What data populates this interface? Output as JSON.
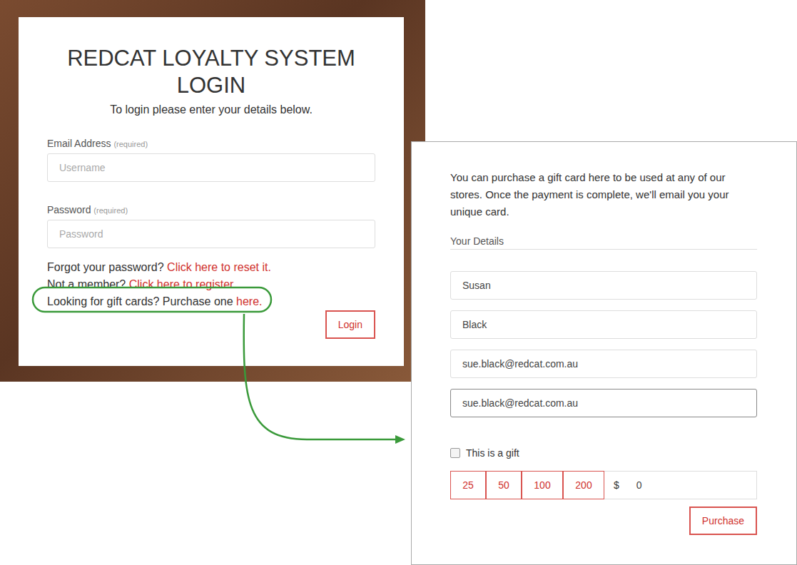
{
  "login": {
    "title_lines": [
      "REDCAT LOYALTY SYSTEM",
      "LOGIN"
    ],
    "subtitle": "To login please enter your details below.",
    "fields": [
      {
        "label": "Email Address",
        "hint": "(required)",
        "placeholder": "Username",
        "type": "text"
      },
      {
        "label": "Password",
        "hint": "(required)",
        "placeholder": "Password",
        "type": "password"
      }
    ],
    "links": [
      {
        "text": "Forgot your password? ",
        "link": "Click here to reset it.",
        "highlighted": false
      },
      {
        "text": "Not a member? ",
        "link": "Click here to register.",
        "highlighted": false
      },
      {
        "text": "Looking for gift cards? Purchase one ",
        "link": "here.",
        "highlighted": true
      }
    ],
    "button": "Login"
  },
  "gift": {
    "intro": "You can purchase a gift card here to be used at any of our stores. Once the payment is complete, we'll email you your unique card.",
    "section": "Your Details",
    "fields": [
      {
        "value": "Susan",
        "focused": false
      },
      {
        "value": "Black",
        "focused": false
      },
      {
        "value": "sue.black@redcat.com.au",
        "focused": false
      },
      {
        "value": "sue.black@redcat.com.au",
        "focused": true
      }
    ],
    "gift_checkbox": {
      "label": "This is a gift",
      "checked": false
    },
    "amounts": [
      "25",
      "50",
      "100",
      "200"
    ],
    "currency": "$",
    "amount": "0",
    "button": "Purchase"
  }
}
